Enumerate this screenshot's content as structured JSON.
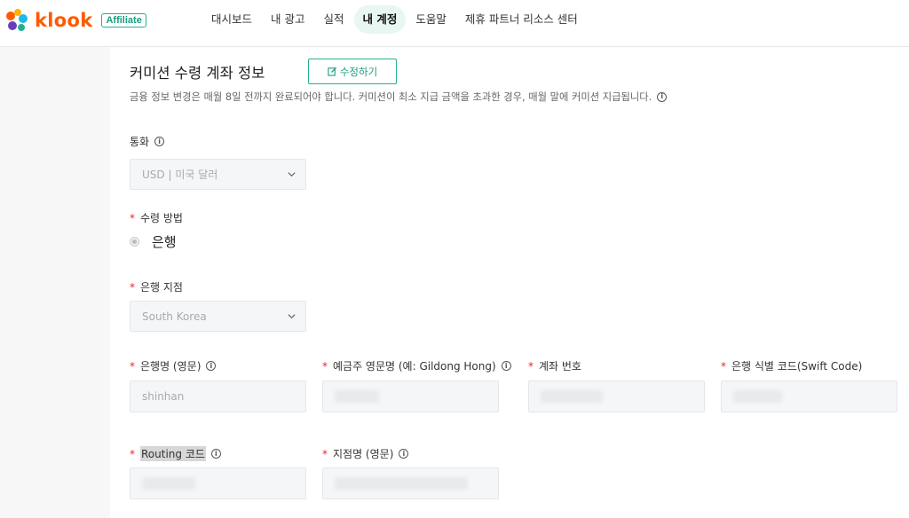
{
  "brand": {
    "name": "klook",
    "badge": "Affiliate"
  },
  "nav": [
    {
      "label": "대시보드",
      "active": false
    },
    {
      "label": "내 광고",
      "active": false
    },
    {
      "label": "실적",
      "active": false
    },
    {
      "label": "내 계정",
      "active": true
    },
    {
      "label": "도움말",
      "active": false
    },
    {
      "label": "제휴 파트너 리소스 센터",
      "active": false
    }
  ],
  "section": {
    "title": "커미션 수령 계좌 정보",
    "edit_label": "수정하기",
    "notice": "금융 정보 변경은 매월 8일 전까지 완료되어야 합니다. 커미션이 최소 지급 금액을 초과한 경우, 매월 말에 커미션 지급됩니다."
  },
  "currency": {
    "label": "통화",
    "value": "USD | 미국 달러"
  },
  "method": {
    "label": "수령 방법",
    "option": "은행"
  },
  "branch": {
    "label": "은행 지점",
    "value": "South Korea"
  },
  "fields": {
    "bank_name": {
      "label": "은행명 (영문)",
      "value": "shinhan"
    },
    "holder_name": {
      "label": "예금주 영문명 (예: Gildong Hong)"
    },
    "account_no": {
      "label": "계좌 번호"
    },
    "swift": {
      "label": "은행 식별 코드(Swift Code)"
    },
    "routing": {
      "label": "Routing 코드"
    },
    "branch_name": {
      "label": "지점명 (영문)"
    }
  },
  "colors": {
    "accent": "#23b08f",
    "brand": "#ff5b00",
    "required": "#ee2233"
  }
}
